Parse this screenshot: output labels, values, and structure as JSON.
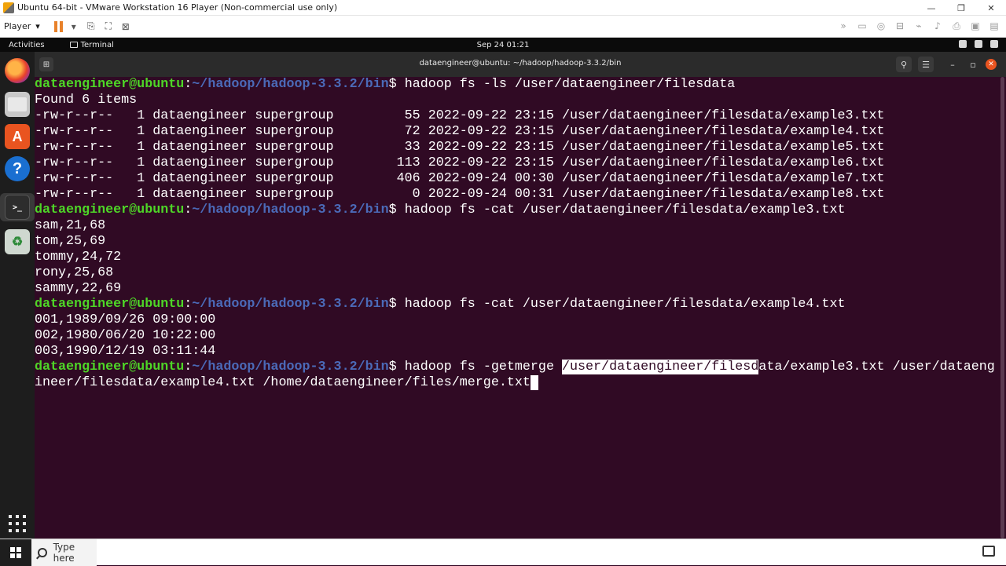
{
  "vm_window": {
    "title": "Ubuntu 64-bit - VMware Workstation 16 Player (Non-commercial use only)",
    "minimize": "—",
    "restore": "❐",
    "close": "✕"
  },
  "vm_toolbar": {
    "player_menu_label": "Player",
    "player_menu_arrow": "▾"
  },
  "ubuntu_topbar": {
    "activities": "Activities",
    "app_name": "Terminal",
    "datetime": "Sep 24  01:21"
  },
  "terminal": {
    "title": "dataengineer@ubuntu: ~/hadoop/hadoop-3.3.2/bin",
    "new_tab_icon": "⊞",
    "search_icon": "⚲",
    "menu_icon": "☰",
    "minimize_icon": "–",
    "maximize_icon": "▫",
    "close_icon": "✕",
    "prompt_user": "dataengineer@ubuntu",
    "prompt_colon": ":",
    "prompt_path": "~/hadoop/hadoop-3.3.2/bin",
    "prompt_symbol": "$ ",
    "cmd_ls": "hadoop fs -ls /user/dataengineer/filesdata",
    "found": "Found 6 items",
    "ls_rows": [
      "-rw-r--r--   1 dataengineer supergroup         55 2022-09-22 23:15 /user/dataengineer/filesdata/example3.txt",
      "-rw-r--r--   1 dataengineer supergroup         72 2022-09-22 23:15 /user/dataengineer/filesdata/example4.txt",
      "-rw-r--r--   1 dataengineer supergroup         33 2022-09-22 23:15 /user/dataengineer/filesdata/example5.txt",
      "-rw-r--r--   1 dataengineer supergroup        113 2022-09-22 23:15 /user/dataengineer/filesdata/example6.txt",
      "-rw-r--r--   1 dataengineer supergroup        406 2022-09-24 00:30 /user/dataengineer/filesdata/example7.txt",
      "-rw-r--r--   1 dataengineer supergroup          0 2022-09-24 00:31 /user/dataengineer/filesdata/example8.txt"
    ],
    "cmd_cat3": "hadoop fs -cat /user/dataengineer/filesdata/example3.txt",
    "cat3_rows": [
      "sam,21,68",
      "tom,25,69",
      "tommy,24,72",
      "rony,25,68",
      "sammy,22,69"
    ],
    "cmd_cat4": "hadoop fs -cat /user/dataengineer/filesdata/example4.txt",
    "cat4_rows": [
      "001,1989/09/26 09:00:00",
      "002,1980/06/20 10:22:00",
      "003,1990/12/19 03:11:44"
    ],
    "cmd_getmerge_prefix": "hadoop fs -getmerge ",
    "cmd_getmerge_selected": "/user/dataengineer/filesd",
    "cmd_getmerge_rest": "ata/example3.txt /user/dataeng",
    "cmd_getmerge_line2": "ineer/filesdata/example4.txt /home/dataengineer/files/merge.txt"
  },
  "dock": {
    "appstore_glyph": "A",
    "help_glyph": "?",
    "terminal_glyph": ">_",
    "trash_glyph": "♻"
  },
  "taskbar": {
    "search_placeholder": "Type here"
  }
}
